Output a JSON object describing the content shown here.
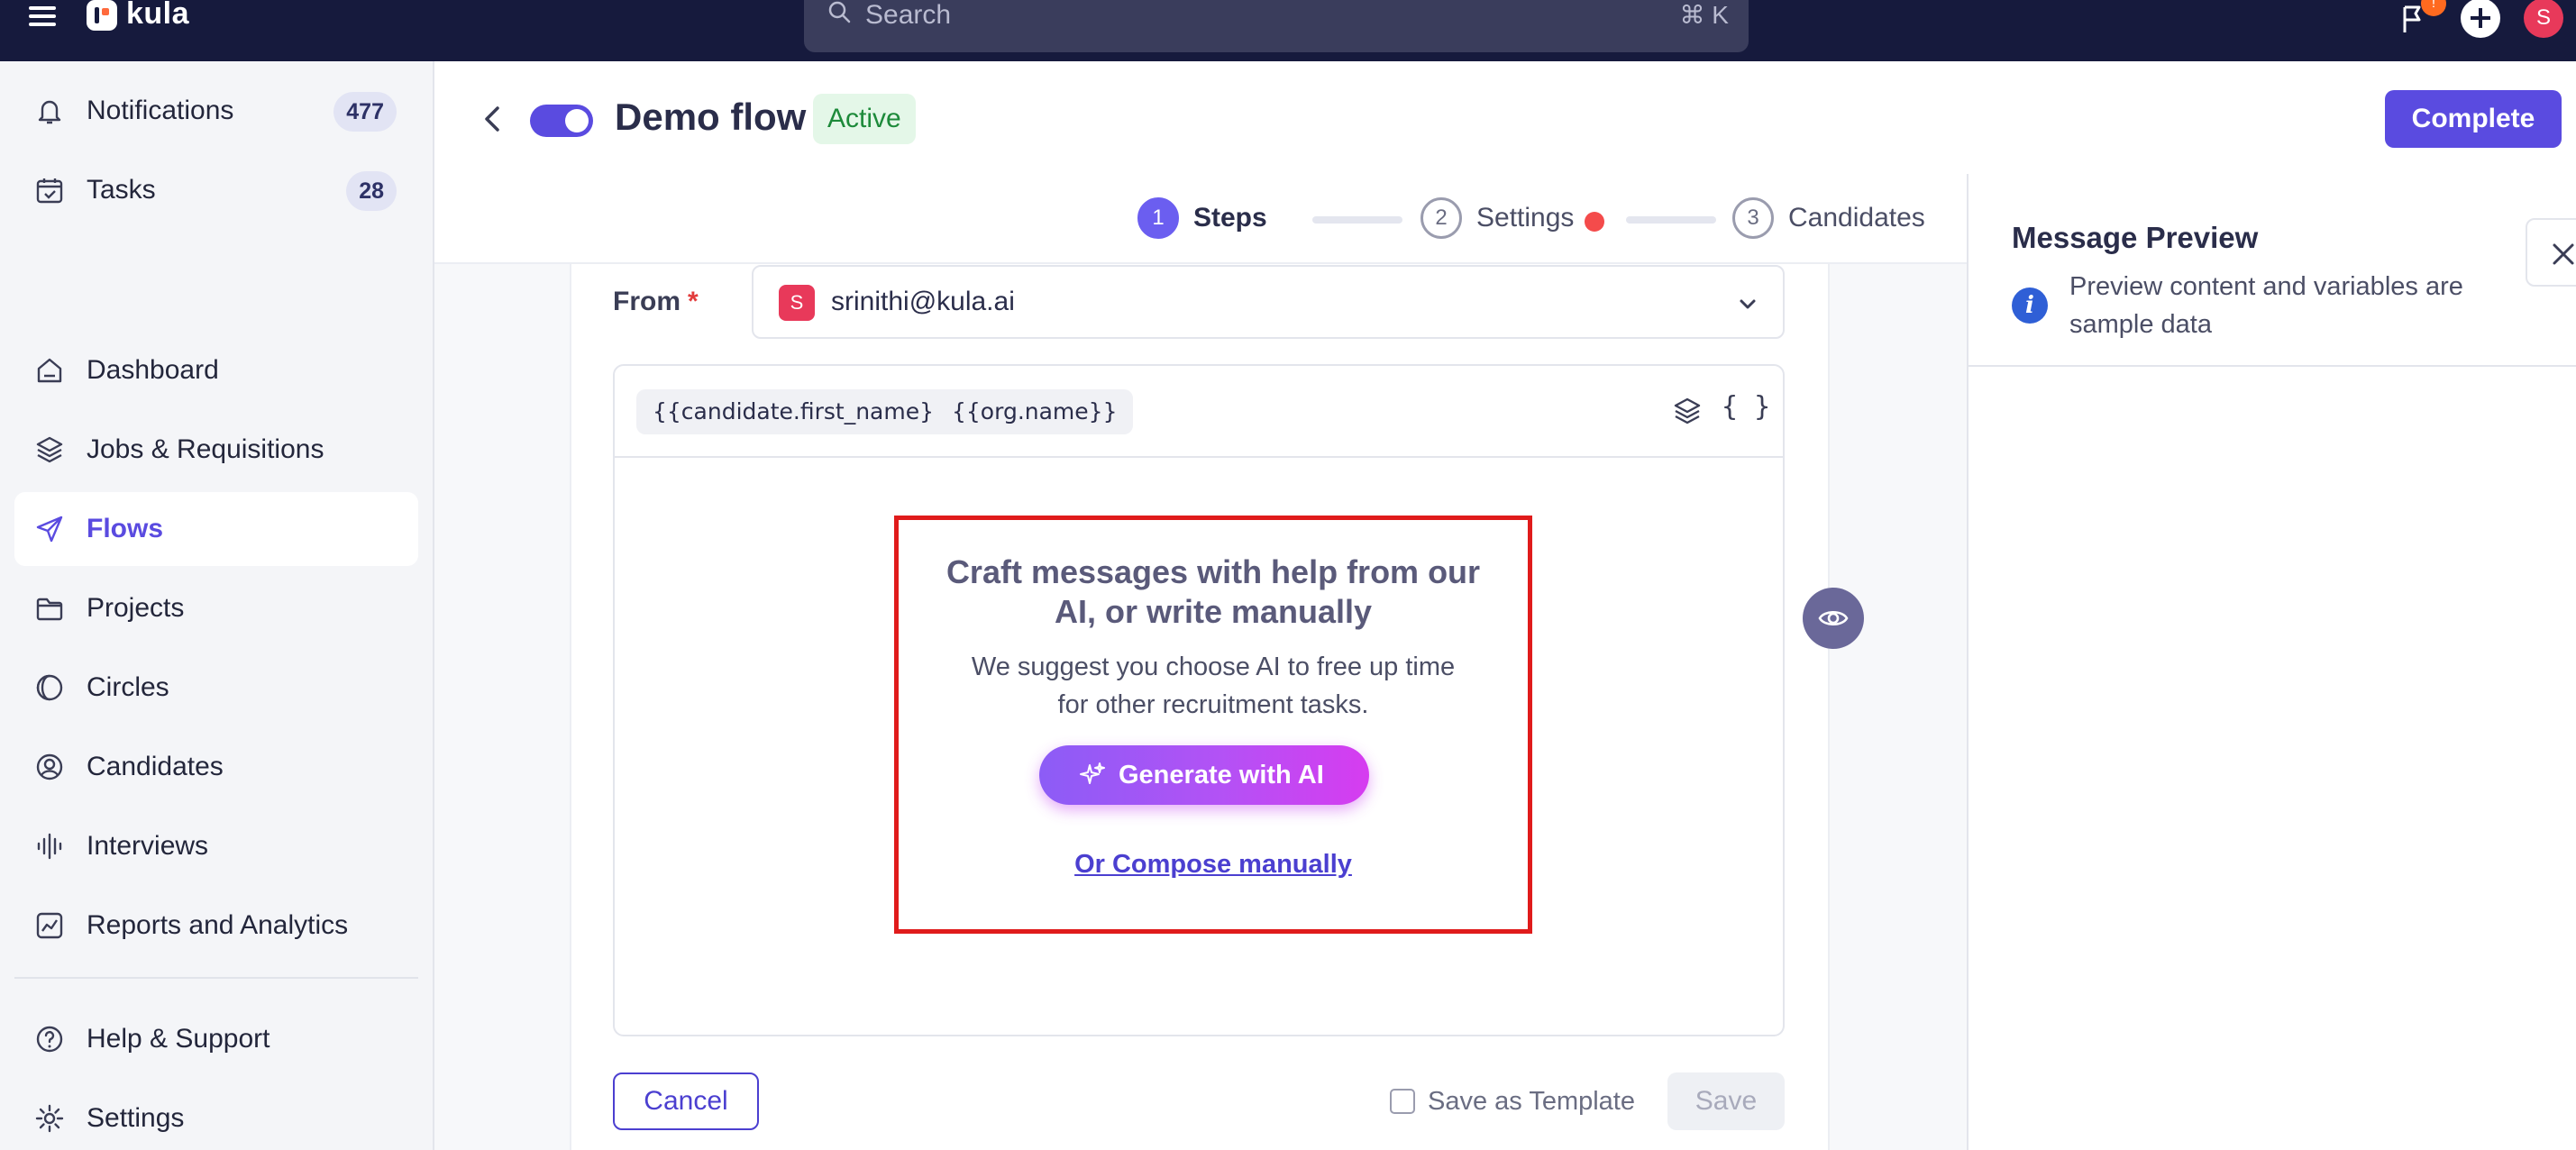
{
  "app": {
    "brand": "kula",
    "search_placeholder": "Search",
    "search_shortcut": "⌘ K",
    "help_badge": "!",
    "user_initial": "S"
  },
  "sidebar": {
    "items": [
      {
        "label": "Notifications",
        "badge": "477",
        "icon": "bell-icon"
      },
      {
        "label": "Tasks",
        "badge": "28",
        "icon": "calendar-check-icon"
      },
      {
        "label": "Dashboard",
        "icon": "home-icon"
      },
      {
        "label": "Jobs & Requisitions",
        "icon": "layers-icon"
      },
      {
        "label": "Flows",
        "icon": "send-icon",
        "active": true
      },
      {
        "label": "Projects",
        "icon": "folder-icon"
      },
      {
        "label": "Circles",
        "icon": "circle-half-icon"
      },
      {
        "label": "Candidates",
        "icon": "user-circle-icon"
      },
      {
        "label": "Interviews",
        "icon": "audio-wave-icon"
      },
      {
        "label": "Reports and Analytics",
        "icon": "chart-icon"
      }
    ],
    "bottom_items": [
      {
        "label": "Help & Support",
        "icon": "question-circle-icon"
      },
      {
        "label": "Settings",
        "icon": "gear-icon"
      }
    ]
  },
  "header": {
    "title": "Demo flow",
    "status": "Active",
    "complete_label": "Complete"
  },
  "stepper": {
    "steps": [
      {
        "number": "1",
        "label": "Steps"
      },
      {
        "number": "2",
        "label": "Settings"
      },
      {
        "number": "3",
        "label": "Candidates"
      }
    ]
  },
  "composer": {
    "from_label": "From",
    "from_required": "*",
    "from_initial": "S",
    "from_value": "srinithi@kula.ai",
    "variables": [
      "{{candidate.first_name}}",
      "{{org.name}}"
    ],
    "braces": "{ }",
    "ai_title": "Craft messages with help from our AI, or write manually",
    "ai_subtitle": "We suggest you choose AI to free up time for other recruitment tasks.",
    "ai_button": "Generate with AI",
    "compose_link": "Or Compose manually",
    "cancel_label": "Cancel",
    "save_template_label": "Save as Template",
    "save_label": "Save"
  },
  "preview": {
    "title": "Message Preview",
    "info_glyph": "i",
    "note": "Preview content and variables are sample data"
  },
  "colors": {
    "topbar": "#161a3d",
    "accent": "#5a4be0",
    "active_green": "#1d8a3a",
    "highlight_border": "#e01b1b"
  }
}
